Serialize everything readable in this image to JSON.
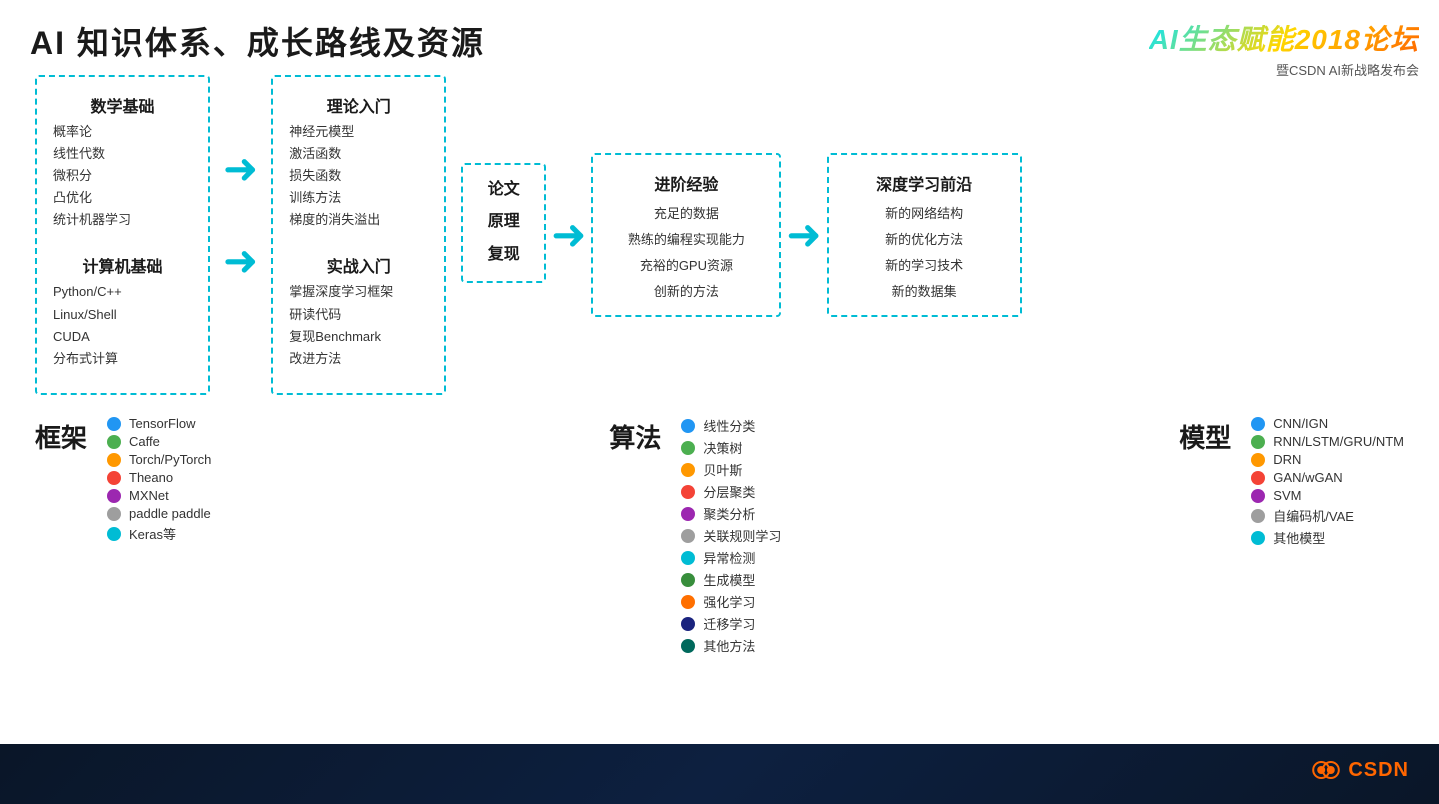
{
  "header": {
    "main_title": "AI 知识体系、成长路线及资源",
    "logo_title": "AI生态赋能2018论坛",
    "logo_subtitle": "暨CSDN AI新战略发布会"
  },
  "flow": {
    "box_math": {
      "sections": [
        {
          "title": "数学基础",
          "items": [
            "概率论",
            "线性代数",
            "微积分",
            "凸优化",
            "统计机器学习"
          ]
        },
        {
          "title": "计算机基础",
          "items": [
            "Python/C++",
            "Linux/Shell",
            "CUDA",
            "分布式计算"
          ]
        }
      ]
    },
    "arrow1": "→",
    "box_theory": {
      "sections": [
        {
          "title": "理论入门",
          "items": [
            "神经元模型",
            "激活函数",
            "损失函数",
            "训练方法",
            "梯度的消失溢出"
          ]
        },
        {
          "title": "实战入门",
          "items": [
            "掌握深度学习框架",
            "研读代码",
            "复现Benchmark",
            "改进方法"
          ]
        }
      ]
    },
    "arrow2": "→",
    "box_paper": {
      "lines": [
        "论文",
        "原理",
        "复现"
      ]
    },
    "arrow3": "→",
    "box_advanced": {
      "title": "进阶经验",
      "items": [
        "充足的数据",
        "熟练的编程实现能力",
        "充裕的GPU资源",
        "创新的方法"
      ]
    },
    "arrow4": "→",
    "box_deep": {
      "title": "深度学习前沿",
      "items": [
        "新的网络结构",
        "新的优化方法",
        "新的学习技术",
        "新的数据集"
      ]
    }
  },
  "frameworks": {
    "label": "框架",
    "items": [
      {
        "color": "#2196f3",
        "name": "TensorFlow"
      },
      {
        "color": "#4caf50",
        "name": "Caffe"
      },
      {
        "color": "#ff9800",
        "name": "Torch/PyTorch"
      },
      {
        "color": "#f44336",
        "name": "Theano"
      },
      {
        "color": "#9c27b0",
        "name": "MXNet"
      },
      {
        "color": "#9e9e9e",
        "name": "paddle paddle"
      },
      {
        "color": "#00bcd4",
        "name": "Keras等"
      }
    ]
  },
  "algorithms": {
    "label": "算法",
    "items": [
      {
        "color": "#2196f3",
        "name": "线性分类"
      },
      {
        "color": "#4caf50",
        "name": "决策树"
      },
      {
        "color": "#ff9800",
        "name": "贝叶斯"
      },
      {
        "color": "#f44336",
        "name": "分层聚类"
      },
      {
        "color": "#9c27b0",
        "name": "聚类分析"
      },
      {
        "color": "#9e9e9e",
        "name": "关联规则学习"
      },
      {
        "color": "#00bcd4",
        "name": "异常检测"
      },
      {
        "color": "#388e3c",
        "name": "生成模型"
      },
      {
        "color": "#ff6f00",
        "name": "强化学习"
      },
      {
        "color": "#1a237e",
        "name": "迁移学习"
      },
      {
        "color": "#00695c",
        "name": "其他方法"
      }
    ]
  },
  "models": {
    "label": "模型",
    "items": [
      {
        "color": "#2196f3",
        "name": "CNN/IGN"
      },
      {
        "color": "#4caf50",
        "name": "RNN/LSTM/GRU/NTM"
      },
      {
        "color": "#ff9800",
        "name": "DRN"
      },
      {
        "color": "#f44336",
        "name": "GAN/wGAN"
      },
      {
        "color": "#9c27b0",
        "name": "SVM"
      },
      {
        "color": "#9e9e9e",
        "name": "自编码机/VAE"
      },
      {
        "color": "#00bcd4",
        "name": "其他模型"
      }
    ]
  },
  "csdn": {
    "text": "CSDN"
  }
}
